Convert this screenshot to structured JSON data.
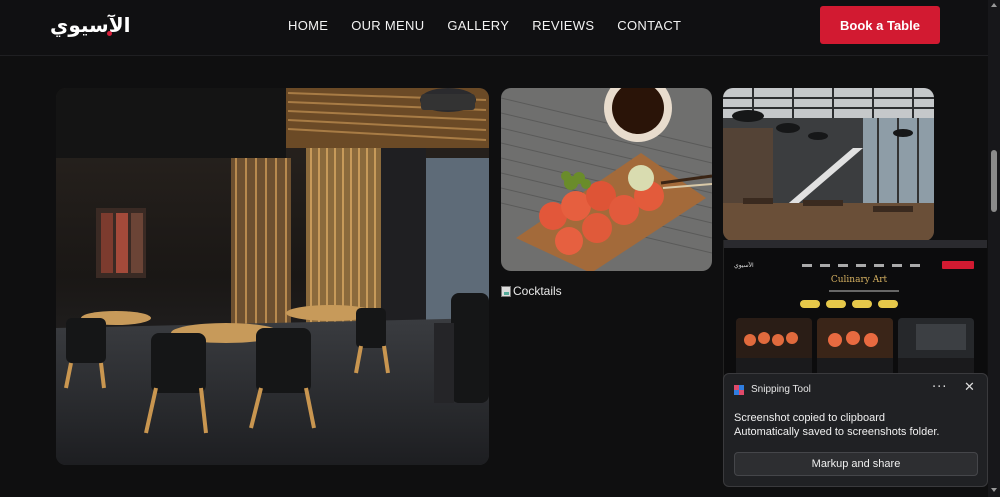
{
  "header": {
    "logo": "الآسيوي",
    "nav": [
      "HOME",
      "OUR MENU",
      "GALLERY",
      "REVIEWS",
      "CONTACT"
    ],
    "cta": "Book a Table"
  },
  "gallery": {
    "broken_image_alt": "Cocktails"
  },
  "embedded_screenshot": {
    "title": "Culinary Art"
  },
  "notification": {
    "app": "Snipping Tool",
    "more": "···",
    "close": "✕",
    "line1": "Screenshot copied to clipboard",
    "line2": "Automatically saved to screenshots folder.",
    "action": "Markup and share"
  },
  "colors": {
    "accent": "#d21a31",
    "background": "#0f0f10",
    "gold": "#d6b161"
  },
  "icons": {
    "snip": "snipping-tool-icon",
    "close": "close-icon",
    "more": "more-options-icon",
    "broken": "broken-image-icon"
  }
}
